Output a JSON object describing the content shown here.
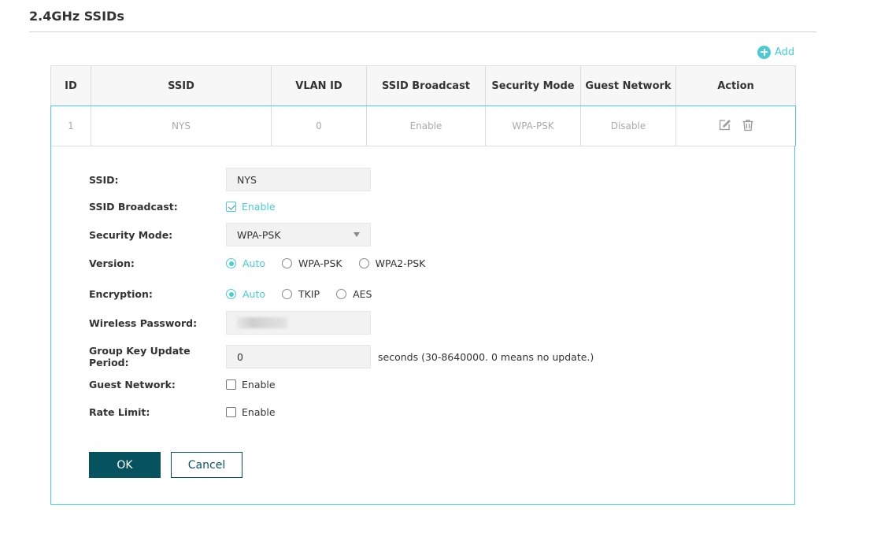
{
  "page": {
    "title": "2.4GHz SSIDs"
  },
  "toolbar": {
    "add_label": "Add"
  },
  "table": {
    "headers": [
      "ID",
      "SSID",
      "VLAN ID",
      "SSID Broadcast",
      "Security Mode",
      "Guest Network",
      "Action"
    ],
    "rows": [
      {
        "id": "1",
        "ssid": "NYS",
        "vlan_id": "0",
        "broadcast": "Enable",
        "security": "WPA-PSK",
        "guest": "Disable"
      }
    ]
  },
  "form": {
    "ssid": {
      "label": "SSID:",
      "value": "NYS"
    },
    "broadcast": {
      "label": "SSID Broadcast:",
      "option": "Enable",
      "checked": true
    },
    "security_mode": {
      "label": "Security Mode:",
      "value": "WPA-PSK"
    },
    "version": {
      "label": "Version:",
      "options": [
        "Auto",
        "WPA-PSK",
        "WPA2-PSK"
      ],
      "selected": "Auto"
    },
    "encryption": {
      "label": "Encryption:",
      "options": [
        "Auto",
        "TKIP",
        "AES"
      ],
      "selected": "Auto"
    },
    "password": {
      "label": "Wireless Password:"
    },
    "group_key": {
      "label_line1": "Group Key Update",
      "label_line2": "Period:",
      "value": "0",
      "hint": "seconds (30-8640000. 0 means no update.)"
    },
    "guest_network": {
      "label": "Guest Network:",
      "option": "Enable",
      "checked": false
    },
    "rate_limit": {
      "label": "Rate Limit:",
      "option": "Enable",
      "checked": false
    },
    "ok_label": "OK",
    "cancel_label": "Cancel"
  },
  "colors": {
    "accent": "#4acbd6",
    "primary": "#06535f",
    "header_bg": "#f7f7f7"
  },
  "icons": {
    "add": "plus-circle-icon",
    "edit": "edit-icon",
    "delete": "trash-icon"
  }
}
